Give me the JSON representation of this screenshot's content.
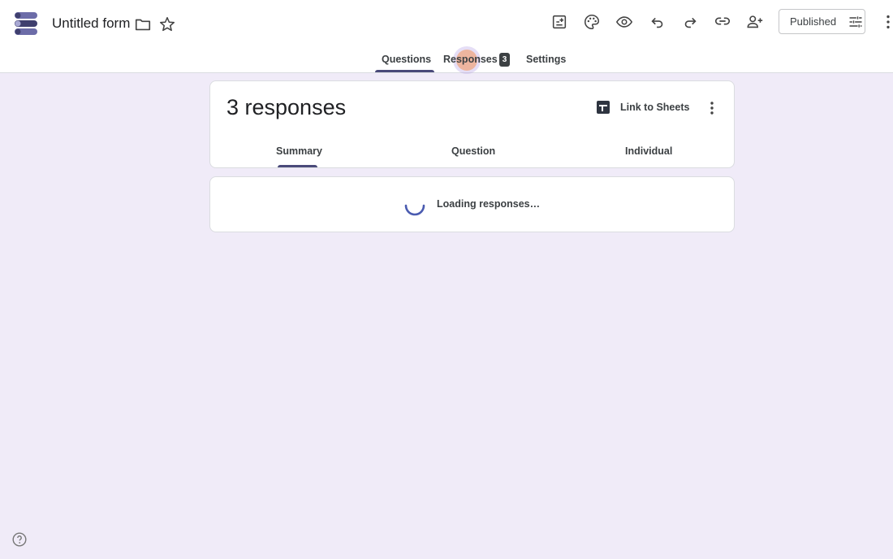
{
  "app": {
    "form_title": "Untitled form",
    "publish_label": "Published"
  },
  "header_icons": [
    "folder-icon",
    "star-icon",
    "addon-icon",
    "palette-icon",
    "preview-icon",
    "undo-icon",
    "redo-icon",
    "link-icon",
    "add-collaborator-icon",
    "settings-sliders-icon",
    "more-vert-icon"
  ],
  "tabs": [
    {
      "label": "Questions"
    },
    {
      "label": "Responses",
      "badge": "3"
    },
    {
      "label": "Settings"
    }
  ],
  "responses": {
    "count_label": "3 responses",
    "sheets_label": "Link to Sheets",
    "subtabs": [
      {
        "label": "Summary"
      },
      {
        "label": "Question"
      },
      {
        "label": "Individual"
      }
    ],
    "loading_text": "Loading responses…"
  },
  "colors": {
    "background": "#f0ebf8",
    "accent": "#4a4a7a"
  }
}
